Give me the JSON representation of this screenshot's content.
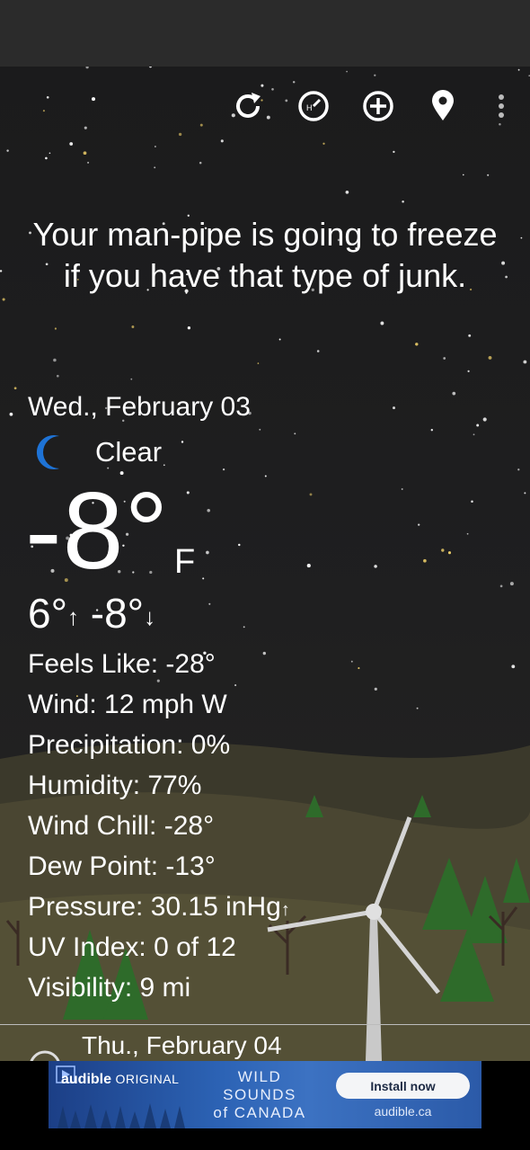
{
  "toolbar": {
    "refresh_icon": "refresh-icon",
    "hourly_icon": "hourly-clock-icon",
    "add_icon": "add-circle-icon",
    "location_icon": "location-pin-icon",
    "menu_icon": "overflow-menu-icon"
  },
  "quote": "Your man-pipe is going to freeze if you have that type of junk.",
  "current": {
    "date": "Wed., February 03",
    "condition": "Clear",
    "condition_icon": "moon-icon",
    "temperature": "-8°",
    "unit": "F",
    "high": "6°",
    "low": "-8°",
    "up_arrow": "↑",
    "down_arrow": "↓"
  },
  "details": [
    {
      "label": "Feels Like",
      "value": "-28°"
    },
    {
      "label": "Wind",
      "value": "12 mph W"
    },
    {
      "label": "Precipitation",
      "value": "0%"
    },
    {
      "label": "Humidity",
      "value": "77%"
    },
    {
      "label": "Wind Chill",
      "value": "-28°"
    },
    {
      "label": "Dew Point",
      "value": "-13°"
    },
    {
      "label": "Pressure",
      "value": "30.15 inHg",
      "trend": "↑"
    },
    {
      "label": "UV Index",
      "value": "0 of 12"
    },
    {
      "label": "Visibility",
      "value": "9 mi"
    }
  ],
  "next_day": {
    "date": "Thu., February 04"
  },
  "ad": {
    "brand": "audible",
    "brand_suffix": "ORIGINAL",
    "title_line1": "WILD",
    "title_line2": "SOUNDS",
    "title_line3": "of CANADA",
    "cta": "Install now",
    "domain": "audible.ca"
  },
  "colors": {
    "sky": "#1e1e1f",
    "moon": "#1e73d6",
    "hill": "#4a4632",
    "tree": "#2e6b2a"
  }
}
